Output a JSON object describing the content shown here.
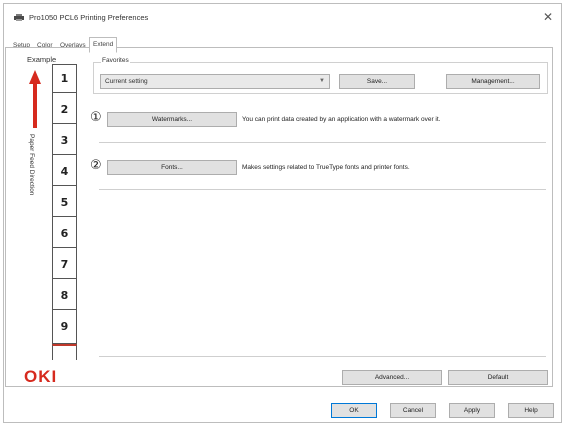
{
  "window": {
    "title": "Pro1050 PCL6 Printing Preferences",
    "close_label": "✕"
  },
  "tabs": [
    {
      "label": "Setup"
    },
    {
      "label": "Color"
    },
    {
      "label": "Overlays"
    },
    {
      "label": "Extend",
      "active": true
    }
  ],
  "example": {
    "label": "Example",
    "feed_direction_label": "Paper Feed Direction",
    "pages": [
      "1",
      "2",
      "3",
      "4",
      "5",
      "6",
      "7",
      "8",
      "9"
    ]
  },
  "favorites": {
    "group_label": "Favorites",
    "selected_value": "Current setting",
    "save_label": "Save...",
    "management_label": "Management..."
  },
  "watermarks": {
    "marker": "①",
    "button_label": "Watermarks...",
    "description": "You can print data created by an application with a watermark over it."
  },
  "fonts": {
    "marker": "②",
    "button_label": "Fonts...",
    "description": "Makes settings related to TrueType fonts and printer fonts."
  },
  "bottom": {
    "advanced_label": "Advanced...",
    "default_label": "Default"
  },
  "footer": {
    "ok_label": "OK",
    "cancel_label": "Cancel",
    "apply_label": "Apply",
    "help_label": "Help"
  },
  "logo": {
    "text": "OKI",
    "color": "#d62a1e"
  },
  "colors": {
    "arrow": "#d62a1e"
  }
}
